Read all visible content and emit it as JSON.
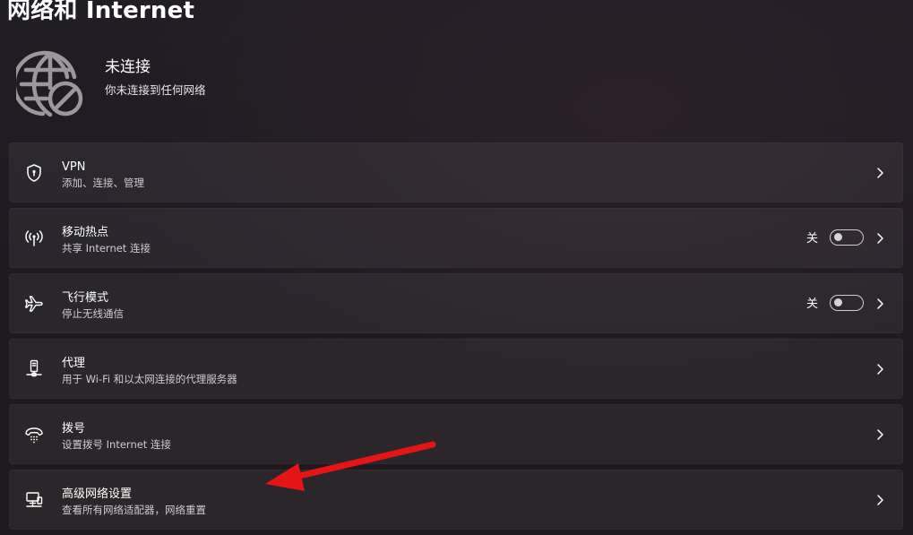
{
  "page": {
    "title": "网络和 Internet"
  },
  "status": {
    "title": "未连接",
    "subtitle": "你未连接到任何网络",
    "icon": "globe-blocked-icon"
  },
  "items": [
    {
      "title": "VPN",
      "subtitle": "添加、连接、管理",
      "icon": "shield-icon"
    },
    {
      "title": "移动热点",
      "subtitle": "共享 Internet 连接",
      "icon": "hotspot-icon",
      "toggle_label": "关",
      "toggle_on": false
    },
    {
      "title": "飞行模式",
      "subtitle": "停止无线通信",
      "icon": "airplane-icon",
      "toggle_label": "关",
      "toggle_on": false
    },
    {
      "title": "代理",
      "subtitle": "用于 Wi-Fi 和以太网连接的代理服务器",
      "icon": "proxy-server-icon"
    },
    {
      "title": "拨号",
      "subtitle": "设置拨号 Internet 连接",
      "icon": "dialup-icon"
    },
    {
      "title": "高级网络设置",
      "subtitle": "查看所有网络适配器，网络重置",
      "icon": "network-computer-icon"
    }
  ],
  "annotation": {
    "color": "#e51515",
    "icon": "red-arrow-annotation"
  },
  "colors": {
    "background": "#201c22",
    "card": "#2c282e",
    "text": "#ffffff",
    "subtext": "#cfcbd1"
  }
}
